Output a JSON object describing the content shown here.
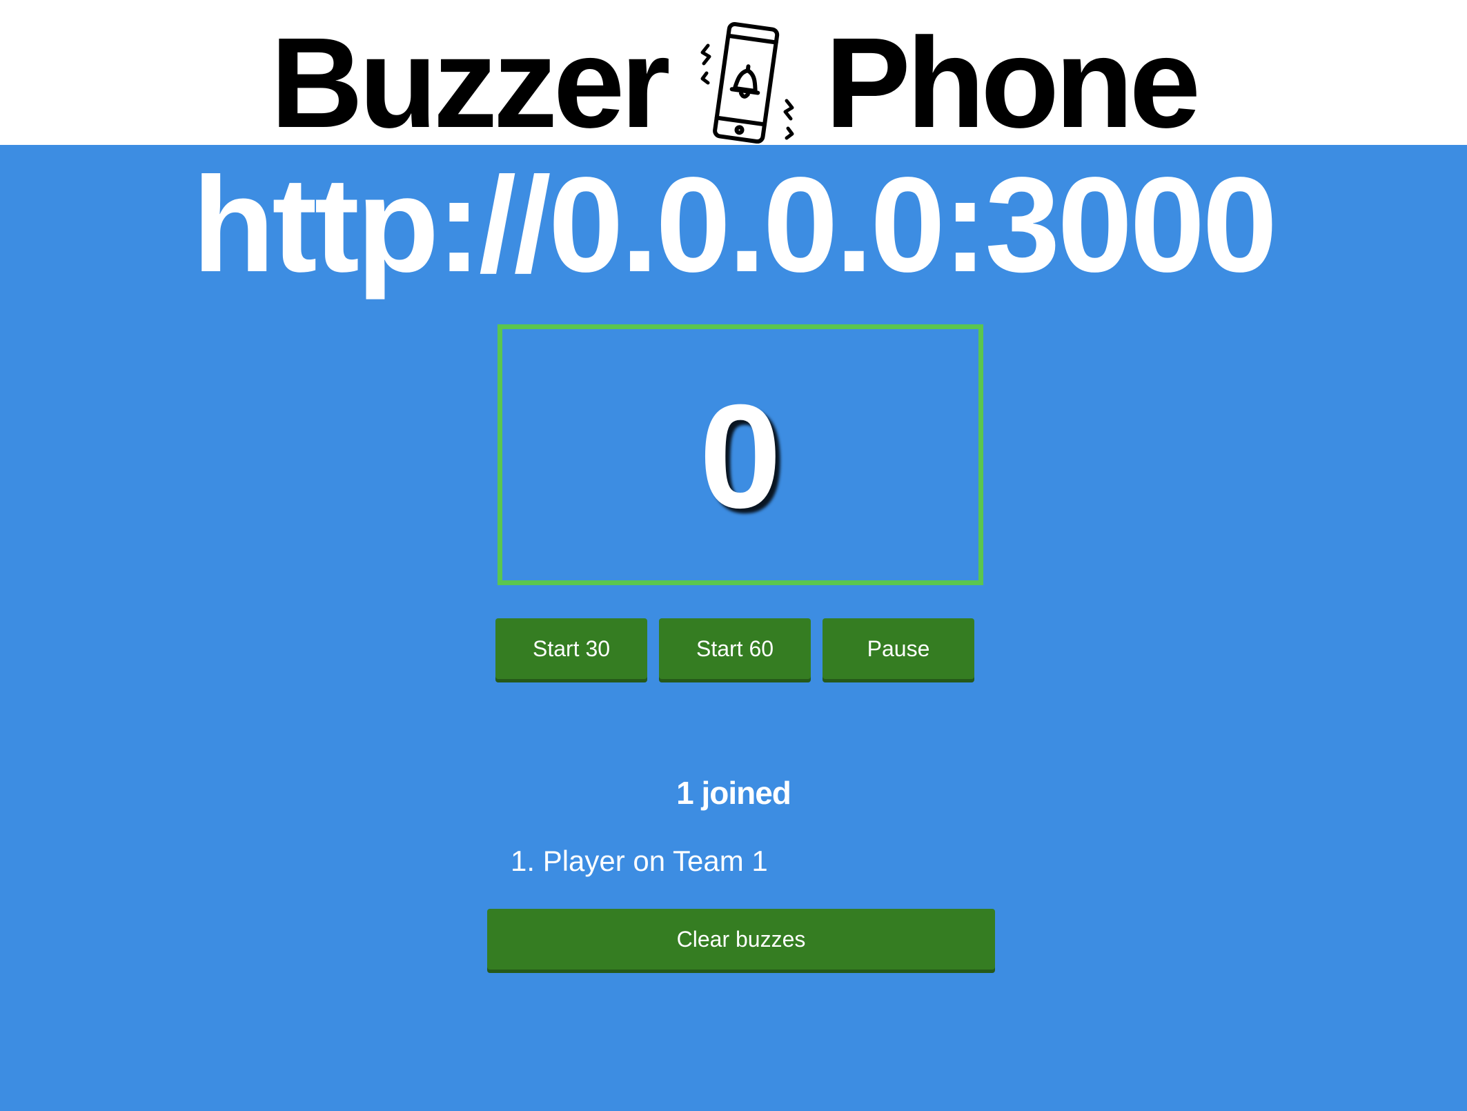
{
  "header": {
    "title_left": "Buzzer",
    "title_right": "Phone",
    "logo_icon": "ringing-phone-icon",
    "background": "#ffffff"
  },
  "url": "http://0.0.0.0:3000",
  "timer": {
    "value": "0",
    "border_color": "#5bc64f"
  },
  "controls": {
    "start30_label": "Start 30",
    "start60_label": "Start 60",
    "pause_label": "Pause"
  },
  "players": {
    "joined_text": "1 joined",
    "list": [
      {
        "label": "1. Player on Team 1"
      }
    ]
  },
  "clear_label": "Clear buzzes",
  "colors": {
    "page_background": "#3d8de2",
    "button_green": "#357d22",
    "text": "#ffffff"
  }
}
